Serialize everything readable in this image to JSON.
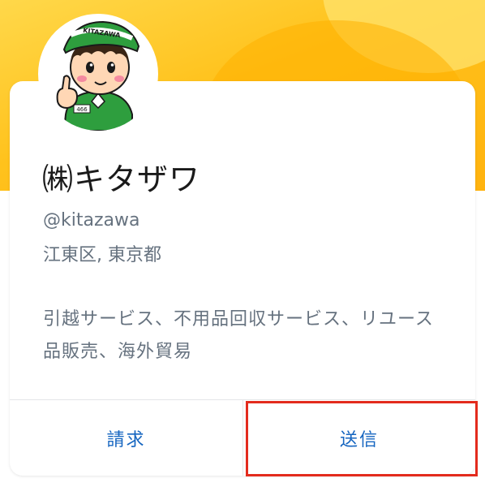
{
  "profile": {
    "name": "㈱キタザワ",
    "handle": "@kitazawa",
    "location": "江東区, 東京都",
    "description": "引越サービス、不用品回収サービス、リユース品販売、海外貿易",
    "avatar_cap_text": "KITAZAWA",
    "avatar_badge_text": "466"
  },
  "actions": {
    "request_label": "請求",
    "send_label": "送信"
  },
  "colors": {
    "banner": "#ffc21c",
    "link_blue": "#1565c0",
    "highlight_red": "#e32b1d",
    "uniform_green": "#2e9e3e"
  },
  "icons": {
    "avatar": "mascot-thumbs-up-icon"
  }
}
